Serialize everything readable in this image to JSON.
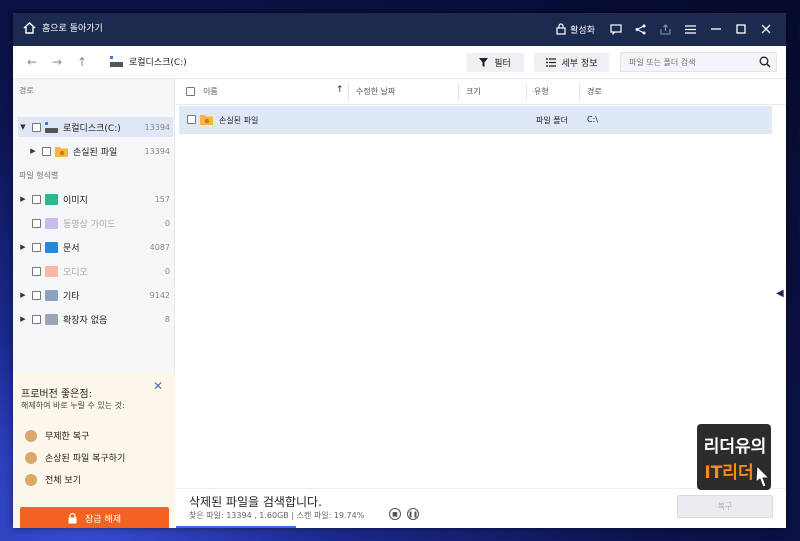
{
  "titlebar": {
    "home_label": "홈으로 돌아가기",
    "activate_label": "활성화"
  },
  "toolbar": {
    "drive_label": "로컬디스크(C:)",
    "filter_label": "필터",
    "details_label": "세부 정보",
    "search_placeholder": "파일 또는 폴더 검색"
  },
  "sidebar": {
    "path_title": "경로",
    "type_title": "파일 형식별",
    "path_items": [
      {
        "label": "로컬디스크(C:)",
        "count": "13394"
      },
      {
        "label": "손실된 파일",
        "count": "13394"
      }
    ],
    "type_items": [
      {
        "label": "이미지",
        "count": "157",
        "color": "#2fb58f"
      },
      {
        "label": "동영상 가이드",
        "count": "0",
        "color": "#a58ce0"
      },
      {
        "label": "문서",
        "count": "4087",
        "color": "#2a86d8"
      },
      {
        "label": "오디오",
        "count": "0",
        "color": "#f08c6b"
      },
      {
        "label": "기타",
        "count": "9142",
        "color": "#8da2bd"
      },
      {
        "label": "확장자 없음",
        "count": "8",
        "color": "#9aa6b8"
      }
    ]
  },
  "promo": {
    "title": "프로버전 좋은점:",
    "subtitle": "해제하여 바로 누릴 수 있는 것:",
    "features": [
      "무제한 복구",
      "손상된 파일 복구하기",
      "전체 보기"
    ],
    "unlock_label": "잠금 해제"
  },
  "table": {
    "columns": [
      "이름",
      "수정한 날짜",
      "크기",
      "유형",
      "경로"
    ],
    "rows": [
      {
        "name": "손실된 파일",
        "date": "",
        "size": "",
        "type": "파일 폴더",
        "path": "C:\\"
      }
    ]
  },
  "status": {
    "title": "삭제된 파일을 검색합니다.",
    "found_text": "찾은 파일: 13394 , 1.60GB | 스캔 파일: 19.74%",
    "progress_fraction": 0.1974,
    "recover_label": "복구"
  },
  "watermark": {
    "line1": "리더유의",
    "line2": "IT리더"
  },
  "colors": {
    "titlebar": "#1b2a4e",
    "accent_orange": "#f26322",
    "selection": "#dfe8f7"
  }
}
